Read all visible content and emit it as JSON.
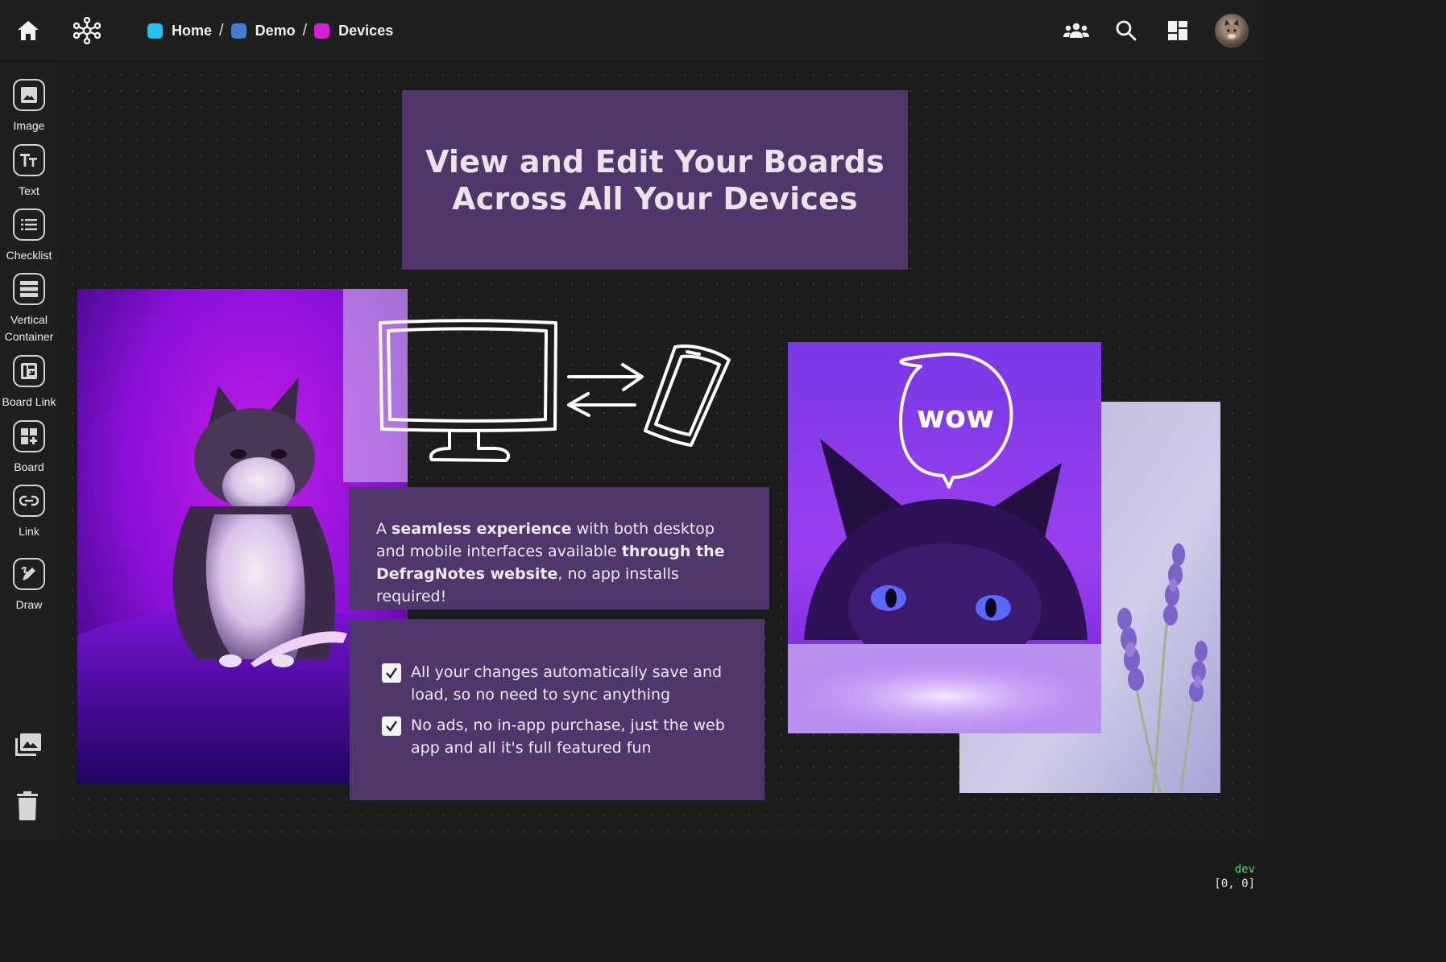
{
  "breadcrumb": [
    {
      "label": "Home",
      "color": "#20c4f4"
    },
    {
      "label": "Demo",
      "color": "#3e7ed8"
    },
    {
      "label": "Devices",
      "color": "#d51ed8"
    }
  ],
  "breadcrumb_separator": "/",
  "topbar_icons": [
    "home-icon",
    "hub-icon",
    "people-icon",
    "search-icon",
    "dashboard-icon",
    "avatar"
  ],
  "sidebar": {
    "tools": [
      {
        "label": "Image",
        "icon": "image-icon"
      },
      {
        "label": "Text",
        "icon": "text-icon"
      },
      {
        "label": "Checklist",
        "icon": "checklist-icon"
      },
      {
        "label": "Vertical Container",
        "icon": "vertical-container-icon"
      },
      {
        "label": "Board Link",
        "icon": "board-link-icon"
      },
      {
        "label": "Board",
        "icon": "board-icon"
      },
      {
        "label": "Link",
        "icon": "link-icon"
      },
      {
        "label": "Draw",
        "icon": "draw-icon"
      }
    ],
    "bottom_icons": [
      "gallery-icon",
      "trash-icon"
    ]
  },
  "board": {
    "title_line1": "View and Edit Your Boards",
    "title_line2": "Across All Your Devices",
    "description": {
      "part1": "A ",
      "bold1": "seamless experience",
      "part2": " with both desktop and mobile interfaces available ",
      "bold2": "through the DefragNotes website",
      "part3": ", no app installs required!"
    },
    "checklist": [
      {
        "text": "All your changes automatically save and load, so no need to sync anything",
        "checked": true
      },
      {
        "text": "No ads, no in-app purchase, just the web app and all it's full featured fun",
        "checked": true
      }
    ],
    "sketch_bubble_text": "wow",
    "card_color": "#4f376c"
  },
  "status": {
    "env": "dev",
    "coords": "[0, 0]",
    "env_color": "#4cd964"
  }
}
